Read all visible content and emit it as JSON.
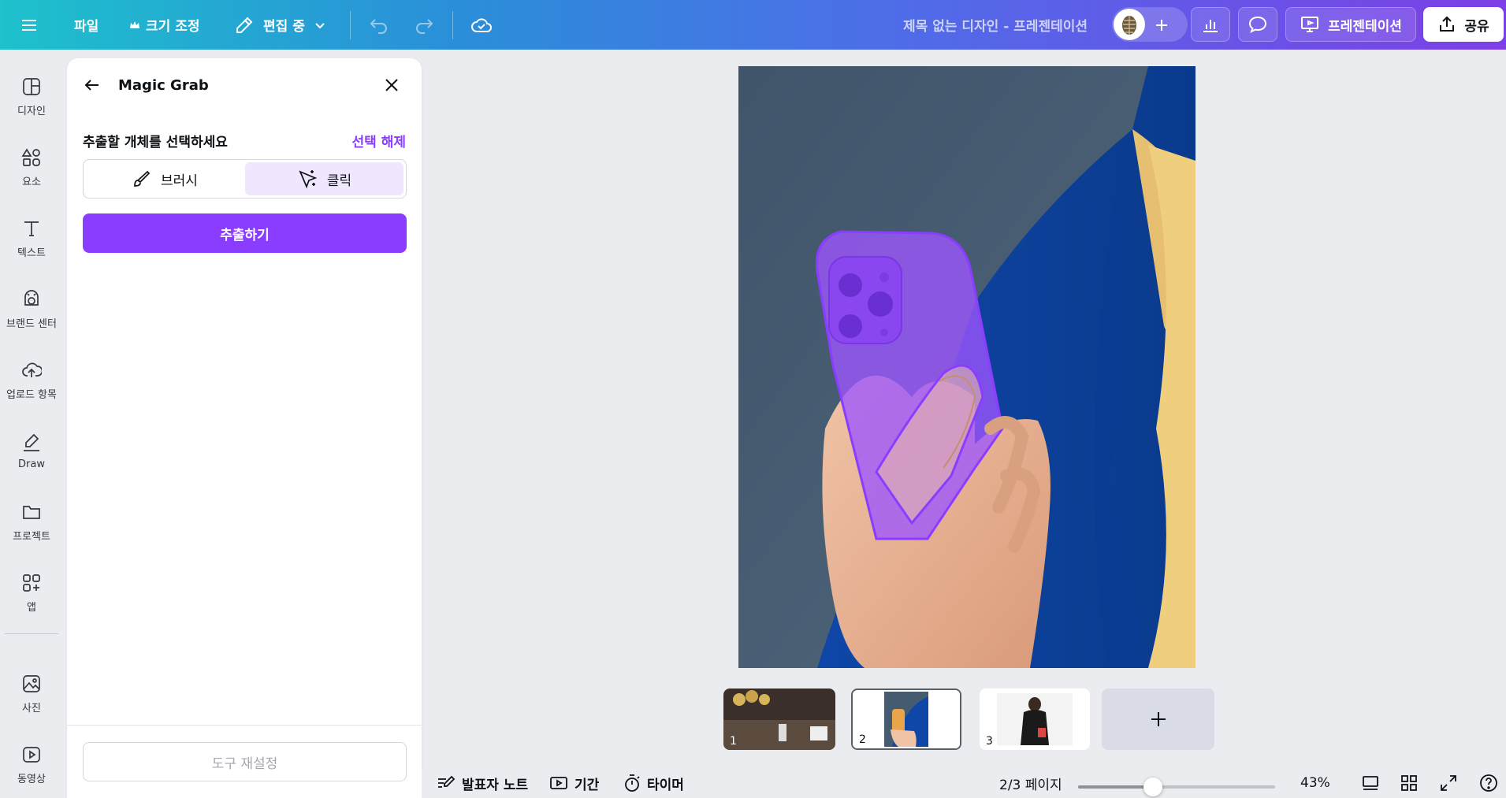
{
  "topbar": {
    "menu_icon": "hamburger-icon",
    "file": "파일",
    "resize": "크기 조정",
    "editing": "편집 중",
    "doc_title": "제목 없는 디자인 - 프레젠테이션",
    "present": "프레젠테이션",
    "share": "공유"
  },
  "rail": {
    "items": [
      {
        "label": "디자인",
        "icon": "design-icon"
      },
      {
        "label": "요소",
        "icon": "elements-icon"
      },
      {
        "label": "텍스트",
        "icon": "text-icon"
      },
      {
        "label": "브랜드 센터",
        "icon": "brand-icon"
      },
      {
        "label": "업로드 항목",
        "icon": "upload-icon"
      },
      {
        "label": "Draw",
        "icon": "draw-icon"
      },
      {
        "label": "프로젝트",
        "icon": "folder-icon"
      },
      {
        "label": "앱",
        "icon": "apps-icon"
      },
      {
        "label": "사진",
        "icon": "photo-icon"
      },
      {
        "label": "동영상",
        "icon": "video-icon"
      }
    ]
  },
  "panel": {
    "title": "Magic Grab",
    "prompt": "추출할 개체를 선택하세요",
    "deselect": "선택 해제",
    "mode_brush": "브러시",
    "mode_click": "클릭",
    "selected_mode": "클릭",
    "extract": "추출하기",
    "reset": "도구 재설정"
  },
  "pages": {
    "thumbs": [
      {
        "num": "1"
      },
      {
        "num": "2"
      },
      {
        "num": "3"
      }
    ],
    "current": 2
  },
  "bottombar": {
    "notes": "발표자 노트",
    "duration": "기간",
    "timer": "타이머",
    "page_indicator": "2/3 페이지",
    "zoom": "43%",
    "zoom_fraction": 0.38
  },
  "colors": {
    "accent": "#8b3dff",
    "selection_overlay": "#9b44ff"
  }
}
